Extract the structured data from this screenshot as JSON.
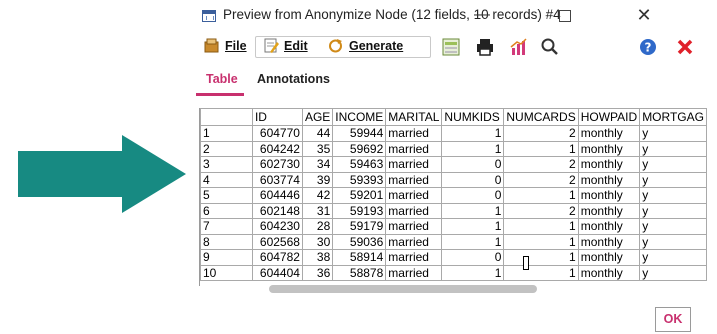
{
  "colors": {
    "arrow": "#178a82",
    "accent": "#c8306e",
    "help": "#2f69c9",
    "close": "#e0202a"
  },
  "window": {
    "title": "Preview from Anonymize Node (12 fields, 10 records) #4"
  },
  "menu": {
    "file": "File",
    "edit": "Edit",
    "generate": "Generate"
  },
  "toolbar_icons": [
    "table-icon",
    "print-icon",
    "chart-icon",
    "search-icon",
    "help-icon",
    "close-red-icon"
  ],
  "tabs": [
    "Table",
    "Annotations"
  ],
  "table": {
    "columns": [
      "",
      "ID",
      "AGE",
      "INCOME",
      "MARITAL",
      "NUMKIDS",
      "NUMCARDS",
      "HOWPAID",
      "MORTGAG"
    ],
    "rows": [
      [
        "1",
        "604770",
        "44",
        "59944",
        "married",
        "1",
        "2",
        "monthly",
        "y"
      ],
      [
        "2",
        "604242",
        "35",
        "59692",
        "married",
        "1",
        "1",
        "monthly",
        "y"
      ],
      [
        "3",
        "602730",
        "34",
        "59463",
        "married",
        "0",
        "2",
        "monthly",
        "y"
      ],
      [
        "4",
        "603774",
        "39",
        "59393",
        "married",
        "0",
        "2",
        "monthly",
        "y"
      ],
      [
        "5",
        "604446",
        "42",
        "59201",
        "married",
        "0",
        "1",
        "monthly",
        "y"
      ],
      [
        "6",
        "602148",
        "31",
        "59193",
        "married",
        "1",
        "2",
        "monthly",
        "y"
      ],
      [
        "7",
        "604230",
        "28",
        "59179",
        "married",
        "1",
        "1",
        "monthly",
        "y"
      ],
      [
        "8",
        "602568",
        "30",
        "59036",
        "married",
        "1",
        "1",
        "monthly",
        "y"
      ],
      [
        "9",
        "604782",
        "38",
        "58914",
        "married",
        "0",
        "1",
        "monthly",
        "y"
      ],
      [
        "10",
        "604404",
        "36",
        "58878",
        "married",
        "1",
        "1",
        "monthly",
        "y"
      ]
    ]
  },
  "ok_button": "OK"
}
